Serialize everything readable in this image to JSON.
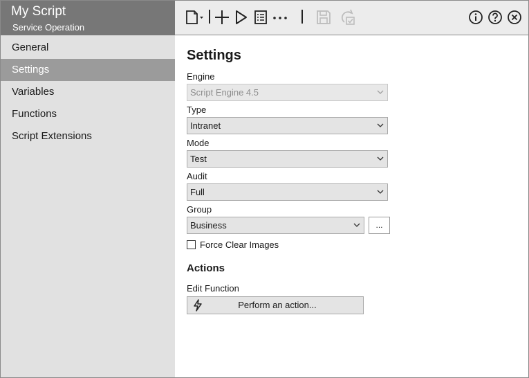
{
  "sidebar": {
    "title": "My Script",
    "subtitle": "Service Operation",
    "items": [
      {
        "label": "General",
        "active": false
      },
      {
        "label": "Settings",
        "active": true
      },
      {
        "label": "Variables",
        "active": false
      },
      {
        "label": "Functions",
        "active": false
      },
      {
        "label": "Script Extensions",
        "active": false
      }
    ]
  },
  "toolbar": {
    "icons": [
      "new-document-dropdown-icon",
      "add-icon",
      "run-icon",
      "list-icon",
      "more-icon",
      "save-icon",
      "refresh-check-icon",
      "info-icon",
      "help-icon",
      "close-icon"
    ],
    "more_label": "···"
  },
  "main": {
    "heading": "Settings",
    "engine": {
      "label": "Engine",
      "value": "Script Engine 4.5",
      "disabled": true
    },
    "type": {
      "label": "Type",
      "value": "Intranet"
    },
    "mode": {
      "label": "Mode",
      "value": "Test"
    },
    "audit": {
      "label": "Audit",
      "value": "Full"
    },
    "group": {
      "label": "Group",
      "value": "Business",
      "browse_label": "..."
    },
    "force_clear_images": {
      "label": "Force Clear Images",
      "checked": false
    },
    "actions_heading": "Actions",
    "edit_function": {
      "label": "Edit Function",
      "button_label": "Perform an action..."
    }
  },
  "colors": {
    "sidebar_header": "#777777",
    "sidebar_bg": "#e1e1e1",
    "nav_active": "#9b9b9b",
    "toolbar_bg": "#ececec"
  }
}
